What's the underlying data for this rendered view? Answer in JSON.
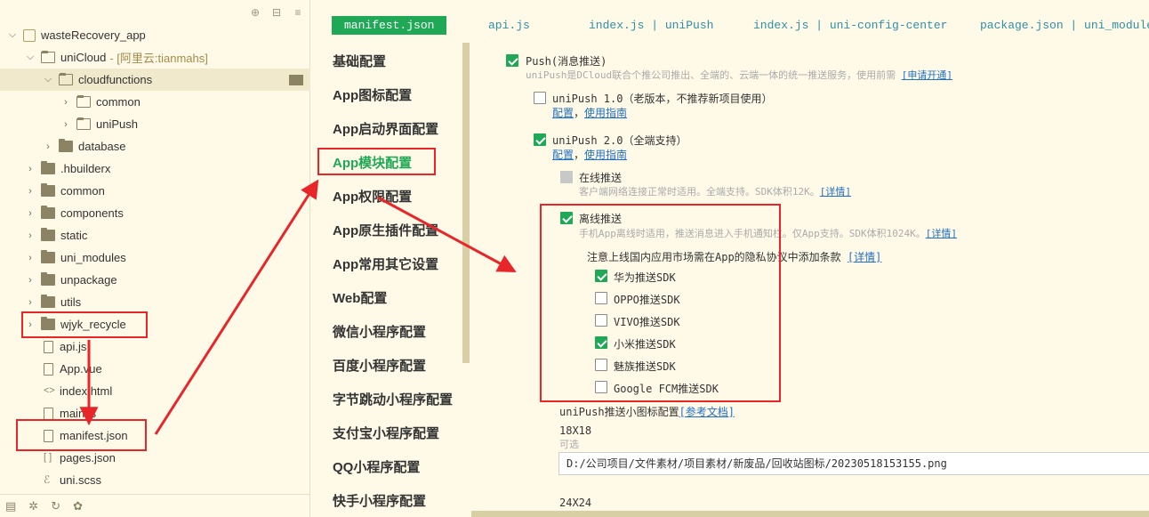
{
  "explorer": {
    "items": [
      {
        "label": "wasteRecovery_app",
        "sub": ""
      },
      {
        "label": "uniCloud",
        "sub": "- [阿里云:tianmahs]"
      },
      {
        "label": "cloudfunctions",
        "sub": ""
      },
      {
        "label": "common",
        "sub": ""
      },
      {
        "label": "uniPush",
        "sub": ""
      },
      {
        "label": "database",
        "sub": ""
      },
      {
        "label": ".hbuilderx",
        "sub": ""
      },
      {
        "label": "common",
        "sub": ""
      },
      {
        "label": "components",
        "sub": ""
      },
      {
        "label": "static",
        "sub": ""
      },
      {
        "label": "uni_modules",
        "sub": ""
      },
      {
        "label": "unpackage",
        "sub": ""
      },
      {
        "label": "utils",
        "sub": ""
      },
      {
        "label": "wjyk_recycle",
        "sub": ""
      },
      {
        "label": "api.js",
        "sub": ""
      },
      {
        "label": "App.vue",
        "sub": ""
      },
      {
        "label": "index.html",
        "sub": ""
      },
      {
        "label": "main.js",
        "sub": ""
      },
      {
        "label": "manifest.json",
        "sub": ""
      },
      {
        "label": "pages.json",
        "sub": ""
      },
      {
        "label": "uni.scss",
        "sub": ""
      }
    ]
  },
  "tabs": [
    {
      "label": "manifest.json",
      "active": true
    },
    {
      "label": "api.js"
    },
    {
      "label": "index.js | uniPush"
    },
    {
      "label": "index.js | uni-config-center"
    },
    {
      "label": "package.json | uni_module.."
    }
  ],
  "nav": [
    "基础配置",
    "App图标配置",
    "App启动界面配置",
    "App模块配置",
    "App权限配置",
    "App原生插件配置",
    "App常用其它设置",
    "Web配置",
    "微信小程序配置",
    "百度小程序配置",
    "字节跳动小程序配置",
    "支付宝小程序配置",
    "QQ小程序配置",
    "快手小程序配置"
  ],
  "content": {
    "push_label": "Push(消息推送)",
    "push_desc": "uniPush是DCloud联合个推公司推出、全端的、云端一体的统一推送服务，使用前需",
    "push_link": "[申请开通]",
    "unipush1_label": "uniPush 1.0（老版本，不推荐新项目使用）",
    "unipush1_links": [
      "配置",
      "使用指南"
    ],
    "unipush2_label": "uniPush 2.0（全端支持）",
    "unipush2_links": [
      "配置",
      "使用指南"
    ],
    "online_label": "在线推送",
    "online_desc": "客户端网络连接正常时适用。全端支持。SDK体积12K。",
    "online_link": "[详情]",
    "offline_label": "离线推送",
    "offline_desc": "手机App离线时适用，推送消息进入手机通知栏。仅App支持。SDK体积1024K。",
    "offline_link": "[详情]",
    "notice": "注意上线国内应用市场需在App的隐私协议中添加条款",
    "notice_link": "[详情]",
    "sdks": [
      {
        "label": "华为推送SDK",
        "checked": true
      },
      {
        "label": "OPPO推送SDK",
        "checked": false
      },
      {
        "label": "VIVO推送SDK",
        "checked": false
      },
      {
        "label": "小米推送SDK",
        "checked": true
      },
      {
        "label": "魅族推送SDK",
        "checked": false
      },
      {
        "label": "Google FCM推送SDK",
        "checked": false
      }
    ],
    "icon_config_label": "uniPush推送小图标配置",
    "icon_config_link": "[参考文档]",
    "size_18": "18X18",
    "optional": "可选",
    "path_value": "D:/公司项目/文件素材/项目素材/新废品/回收站图标/20230518153155.png",
    "size_24": "24X24"
  }
}
